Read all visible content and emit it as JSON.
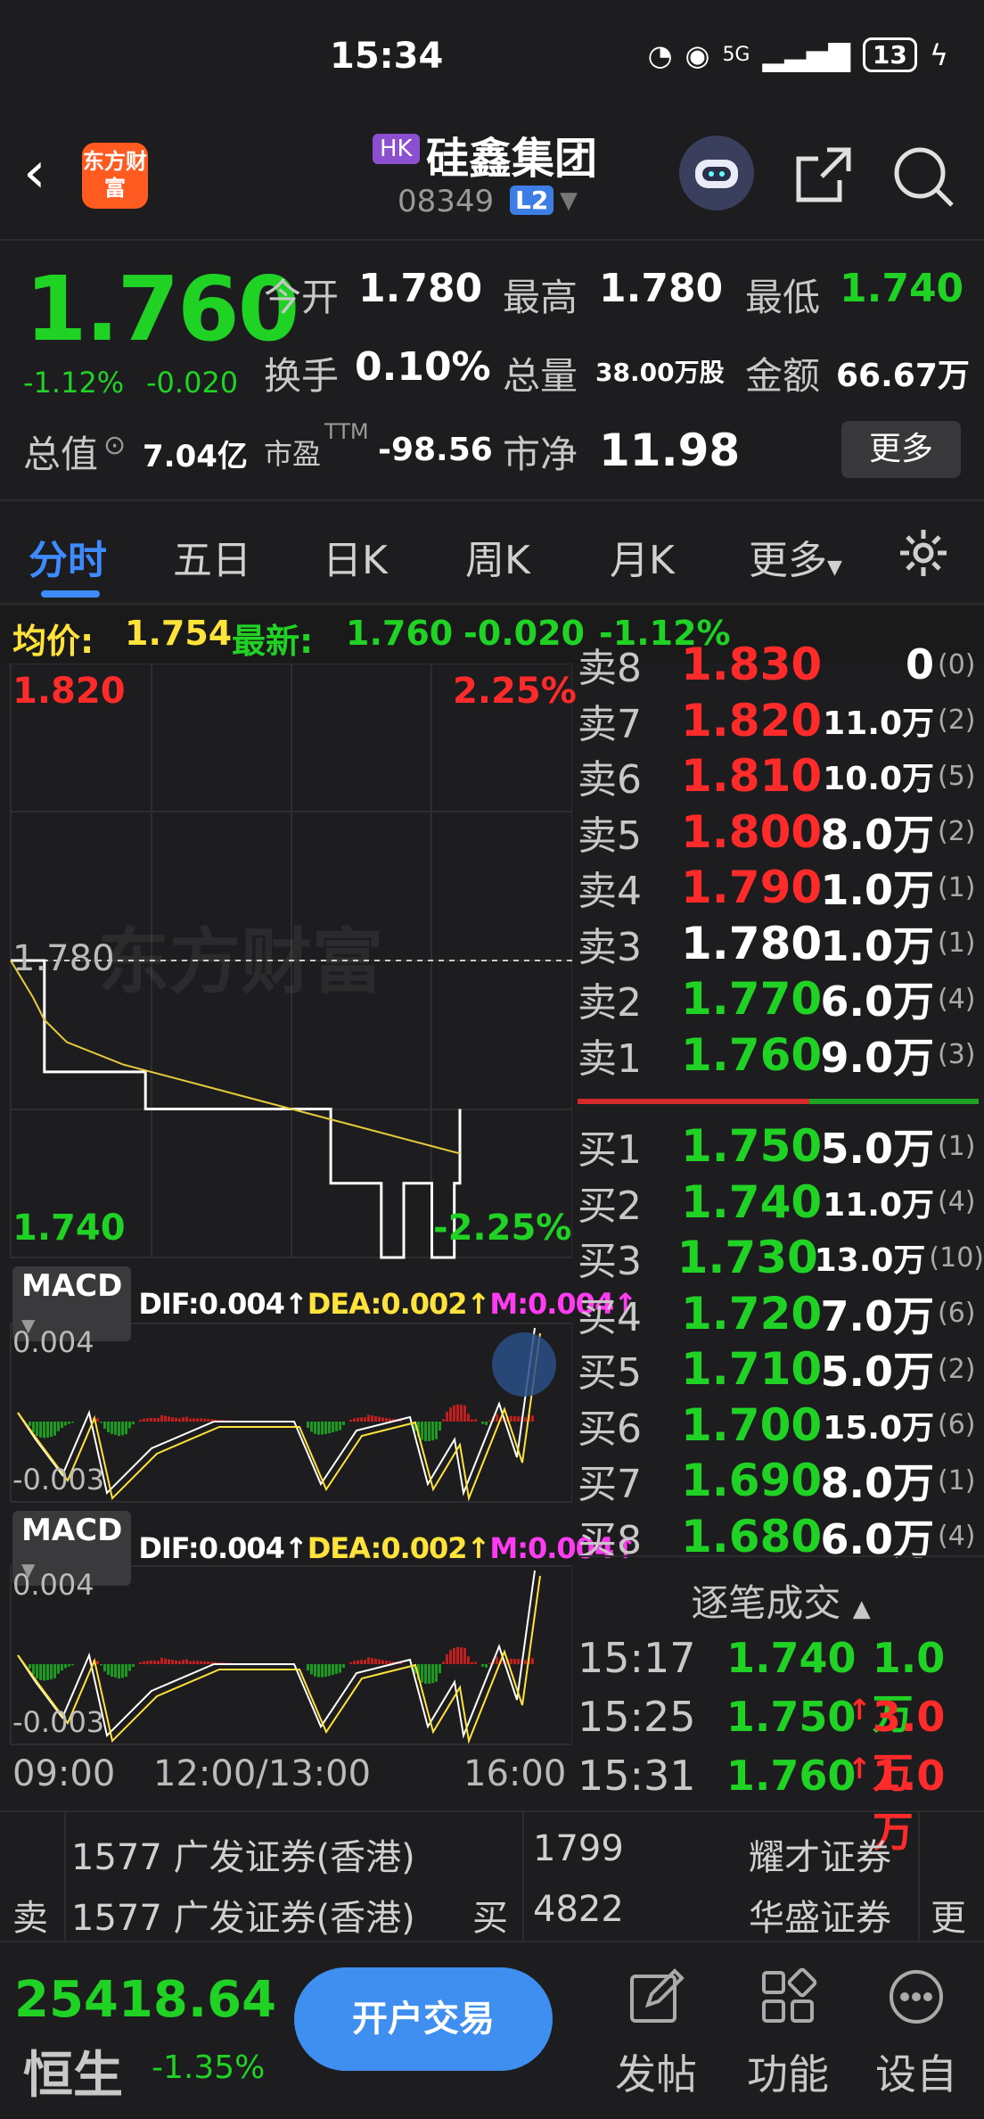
{
  "status_bar": {
    "time": "15:34",
    "network": "5G",
    "battery": "13"
  },
  "header": {
    "logo_text": "东方财富",
    "market_badge": "HK",
    "stock_name": "硅鑫集团",
    "stock_code": "08349",
    "level_badge": "L2"
  },
  "quote": {
    "last": "1.760",
    "pct": "-1.12%",
    "change": "-0.020",
    "open_label": "今开",
    "open": "1.780",
    "high_label": "最高",
    "high": "1.780",
    "low_label": "最低",
    "low": "1.740",
    "turnover_label": "换手",
    "turnover": "0.10%",
    "volume_label": "总量",
    "volume": "38.00万股",
    "amount_label": "金额",
    "amount": "66.67万",
    "mcap_label": "总值",
    "mcap": "7.04亿",
    "pe_label": "市盈",
    "pe_sup": "TTM",
    "pe": "-98.56",
    "pb_label": "市净",
    "pb": "11.98",
    "more_label": "更多"
  },
  "tabs": [
    {
      "label": "分时"
    },
    {
      "label": "五日"
    },
    {
      "label": "日K"
    },
    {
      "label": "周K"
    },
    {
      "label": "月K"
    },
    {
      "label": "更多"
    }
  ],
  "avg_line": {
    "avg_label": "均价:",
    "avg": "1.754",
    "latest_label": "最新:",
    "latest": "1.760",
    "change": "-0.020",
    "pct": "-1.12%"
  },
  "chart": {
    "price_max": "1.820",
    "pct_max": "2.25%",
    "price_mid": "1.780",
    "price_min": "1.740",
    "pct_min": "-2.25%",
    "watermark": "东方财富",
    "x_labels": [
      "09:00",
      "12:00/13:00",
      "16:00"
    ],
    "macd": [
      {
        "tag": "MACD",
        "dif": "DIF:0.004↑",
        "dea": "DEA:0.002↑",
        "m": "M:0.004↑",
        "top": "0.004",
        "bottom": "-0.003"
      },
      {
        "tag": "MACD",
        "dif": "DIF:0.004↑",
        "dea": "DEA:0.002↑",
        "m": "M:0.004↑",
        "top": "0.004",
        "bottom": "-0.003"
      }
    ]
  },
  "chart_data": {
    "type": "line",
    "series": [
      {
        "name": "price",
        "x": [
          0,
          4,
          6,
          10,
          20,
          24,
          30,
          34,
          43,
          50,
          53,
          57,
          60,
          63,
          66,
          70,
          72,
          75,
          77,
          79,
          80
        ],
        "values": [
          1.78,
          1.78,
          1.765,
          1.765,
          1.765,
          1.76,
          1.76,
          1.76,
          1.76,
          1.76,
          1.76,
          1.75,
          1.75,
          1.75,
          1.74,
          1.75,
          1.75,
          1.74,
          1.74,
          1.75,
          1.76
        ]
      },
      {
        "name": "avg",
        "x": [
          0,
          4,
          6,
          10,
          20,
          30,
          40,
          50,
          60,
          70,
          75,
          80
        ],
        "values": [
          1.78,
          1.775,
          1.772,
          1.769,
          1.766,
          1.764,
          1.762,
          1.76,
          1.758,
          1.756,
          1.755,
          1.754
        ]
      }
    ],
    "ylim": [
      1.74,
      1.82
    ]
  },
  "order_book": {
    "asks": [
      {
        "label": "卖8",
        "price": "1.830",
        "vol": "0",
        "count": "(0)",
        "color": "#ff2a2a"
      },
      {
        "label": "卖7",
        "price": "1.820",
        "vol": "11.0万",
        "count": "(2)",
        "color": "#ff2a2a"
      },
      {
        "label": "卖6",
        "price": "1.810",
        "vol": "10.0万",
        "count": "(5)",
        "color": "#ff2a2a"
      },
      {
        "label": "卖5",
        "price": "1.800",
        "vol": "8.0万",
        "count": "(2)",
        "color": "#ff2a2a"
      },
      {
        "label": "卖4",
        "price": "1.790",
        "vol": "1.0万",
        "count": "(1)",
        "color": "#ff2a2a"
      },
      {
        "label": "卖3",
        "price": "1.780",
        "vol": "1.0万",
        "count": "(1)",
        "color": "#ffffff"
      },
      {
        "label": "卖2",
        "price": "1.770",
        "vol": "6.0万",
        "count": "(4)",
        "color": "#1fd224"
      },
      {
        "label": "卖1",
        "price": "1.760",
        "vol": "9.0万",
        "count": "(3)",
        "color": "#1fd224"
      }
    ],
    "bids": [
      {
        "label": "买1",
        "price": "1.750",
        "vol": "5.0万",
        "count": "(1)"
      },
      {
        "label": "买2",
        "price": "1.740",
        "vol": "11.0万",
        "count": "(4)"
      },
      {
        "label": "买3",
        "price": "1.730",
        "vol": "13.0万",
        "count": "(10)"
      },
      {
        "label": "买4",
        "price": "1.720",
        "vol": "7.0万",
        "count": "(6)"
      },
      {
        "label": "买5",
        "price": "1.710",
        "vol": "5.0万",
        "count": "(2)"
      },
      {
        "label": "买6",
        "price": "1.700",
        "vol": "15.0万",
        "count": "(6)"
      },
      {
        "label": "买7",
        "price": "1.690",
        "vol": "8.0万",
        "count": "(1)"
      },
      {
        "label": "买8",
        "price": "1.680",
        "vol": "6.0万",
        "count": "(4)"
      }
    ]
  },
  "trades": {
    "title": "逐笔成交",
    "rows": [
      {
        "time": "15:17",
        "price": "1.740",
        "arrow": "",
        "vol": "1.0万",
        "vol_color": "#1fd224"
      },
      {
        "time": "15:25",
        "price": "1.750",
        "arrow": "↑",
        "vol": "3.0万",
        "vol_color": "#ff2a2a"
      },
      {
        "time": "15:31",
        "price": "1.760",
        "arrow": "↑",
        "vol": "1.0万",
        "vol_color": "#ff2a2a"
      }
    ]
  },
  "brokers": {
    "sell_label": "卖",
    "buy_label": "买",
    "more_label": "更",
    "sell": [
      {
        "id": "1577",
        "name": "广发证券(香港)"
      },
      {
        "id": "1577",
        "name": "广发证券(香港)"
      }
    ],
    "buy": [
      {
        "id": "1799",
        "name": "耀才证券"
      },
      {
        "id": "4822",
        "name": "华盛证券"
      }
    ]
  },
  "bottom": {
    "index_value": "25418.64",
    "index_name": "恒生",
    "index_pct": "-1.35%",
    "open_account": "开户交易",
    "post": "发帖",
    "functions": "功能",
    "custom": "设自"
  },
  "colors": {
    "up": "#ff2a2a",
    "down": "#1fd224",
    "accent": "#3d8bff",
    "avg": "#ffe23a"
  }
}
